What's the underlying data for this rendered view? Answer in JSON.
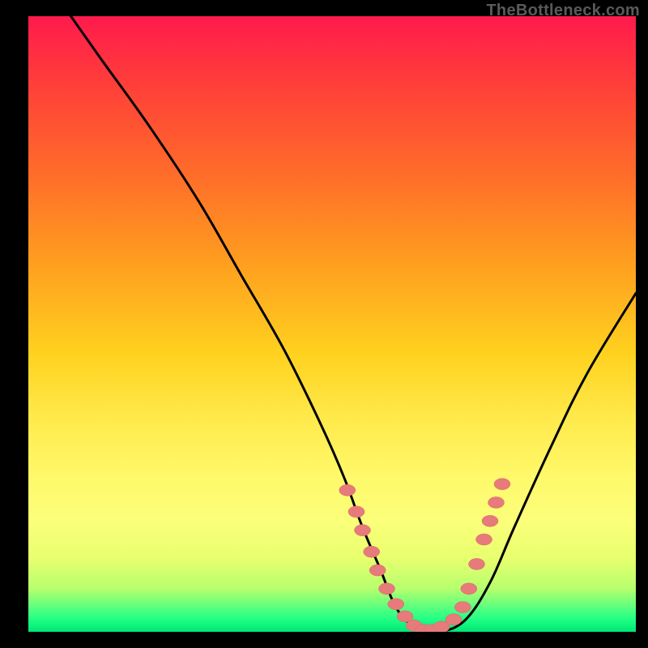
{
  "watermark": "TheBottleneck.com",
  "colors": {
    "page_bg": "#000000",
    "gradient_top": "#ff1a4d",
    "gradient_bottom": "#00e676",
    "curve": "#000000",
    "dots": "#e77a7a"
  },
  "chart_data": {
    "type": "line",
    "title": "",
    "xlabel": "",
    "ylabel": "",
    "xlim": [
      0,
      100
    ],
    "ylim": [
      0,
      100
    ],
    "series": [
      {
        "name": "curve",
        "x": [
          7,
          12,
          20,
          28,
          35,
          42,
          48,
          52,
          55,
          58,
          60,
          62,
          65,
          68,
          72,
          76,
          80,
          86,
          92,
          100
        ],
        "y": [
          100,
          93,
          82,
          70,
          58,
          46,
          34,
          25,
          17,
          10,
          5,
          2,
          0,
          0,
          2,
          8,
          17,
          30,
          42,
          55
        ]
      }
    ],
    "highlight_points": {
      "name": "dots",
      "x": [
        52.5,
        54.0,
        55.0,
        56.5,
        57.5,
        59.0,
        60.5,
        62.0,
        63.5,
        65.0,
        66.5,
        68.0,
        70.0,
        71.5,
        72.5,
        73.8,
        75.0,
        76.0,
        77.0,
        78.0
      ],
      "y": [
        23.0,
        19.5,
        16.5,
        13.0,
        10.0,
        7.0,
        4.5,
        2.5,
        1.0,
        0.3,
        0.3,
        0.8,
        2.0,
        4.0,
        7.0,
        11.0,
        15.0,
        18.0,
        21.0,
        24.0
      ]
    }
  }
}
